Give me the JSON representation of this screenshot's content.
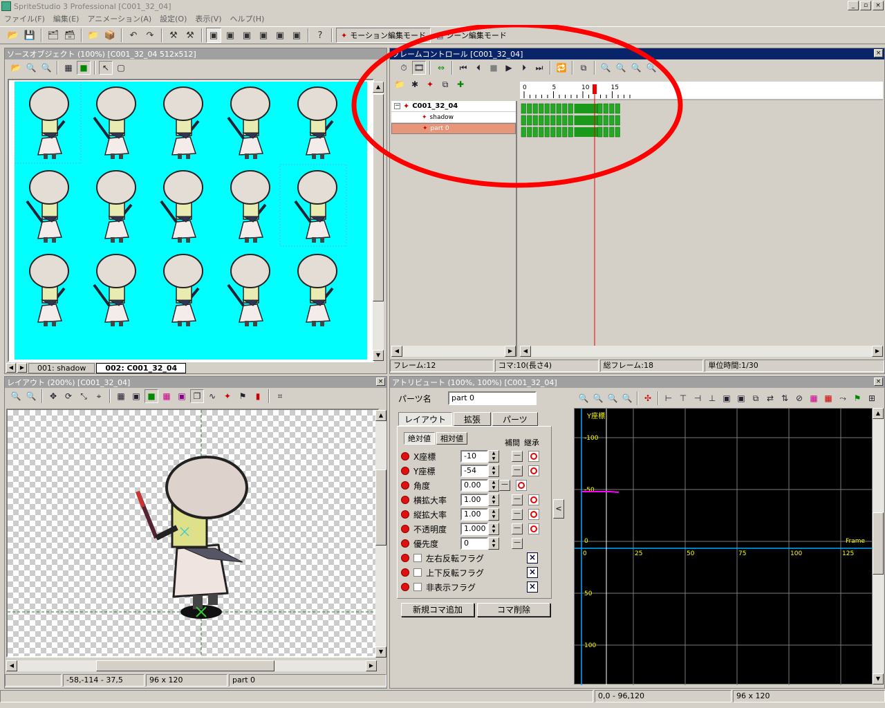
{
  "window": {
    "title": "SpriteStudio 3 Professional [C001_32_04]",
    "buttons": [
      "_",
      "▫",
      "×"
    ]
  },
  "menu": [
    "ファイル(F)",
    "編集(E)",
    "アニメーション(A)",
    "設定(O)",
    "表示(V)",
    "ヘルプ(H)"
  ],
  "modes": {
    "motion": "モーション編集モード",
    "scene": "シーン編集モード"
  },
  "source_panel": {
    "title": "ソースオブジェクト (100%) [C001_32_04  512x512]",
    "tabs": [
      "001: shadow",
      "002: C001_32_04"
    ],
    "background": "#00ffff"
  },
  "frame_panel": {
    "title": "フレームコントロール [C001_32_04]",
    "tree": {
      "root": "C001_32_04",
      "children": [
        "shadow",
        "part 0"
      ]
    },
    "ruler": [
      "0",
      "5",
      "10",
      "15"
    ],
    "status": [
      "フレーム:12",
      "コマ:10(長さ4)",
      "総フレーム:18",
      "単位時間:1/30"
    ]
  },
  "layout_panel": {
    "title": "レイアウト (200%) [C001_32_04]",
    "status": [
      "",
      "-58,-114 - 37,5",
      "96 x 120",
      "part 0"
    ]
  },
  "attr_panel": {
    "title": "アトリビュート (100%, 100%) [C001_32_04]",
    "parts_name_label": "パーツ名",
    "parts_name_value": "part 0",
    "tabs": [
      "レイアウト",
      "拡張",
      "パーツ"
    ],
    "subtabs": [
      "絶対値",
      "相対値"
    ],
    "col_headers": [
      "補間",
      "継承"
    ],
    "numeric_rows": [
      {
        "label": "X座標",
        "value": "-10"
      },
      {
        "label": "Y座標",
        "value": "-54"
      },
      {
        "label": "角度",
        "value": "0.00"
      },
      {
        "label": "横拡大率",
        "value": "1.00"
      },
      {
        "label": "縦拡大率",
        "value": "1.00"
      },
      {
        "label": "不透明度",
        "value": "1.000"
      },
      {
        "label": "優先度",
        "value": "0"
      }
    ],
    "flag_rows": [
      "左右反転フラグ",
      "上下反転フラグ",
      "非表示フラグ"
    ],
    "add_button": "新規コマ追加",
    "delete_button": "コマ削除"
  },
  "graph": {
    "title": "Y座標",
    "frame_label": "Frame",
    "y_labels": [
      "-100",
      "-50",
      "0",
      "50",
      "100"
    ],
    "x_labels": [
      "0",
      "25",
      "50",
      "75",
      "100",
      "125"
    ]
  },
  "bottom_status": [
    "",
    "0,0 - 96,120",
    "96 x 120"
  ],
  "colors": {
    "active_title": "#0a246a",
    "annotation": "#ff0000",
    "track_fill": "#22aa22"
  }
}
